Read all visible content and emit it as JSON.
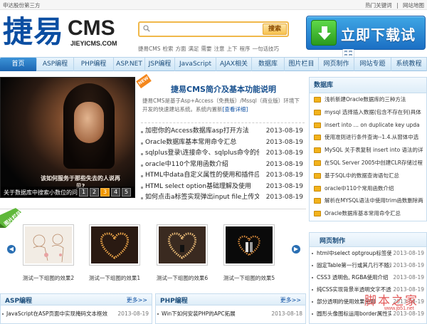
{
  "topbar": {
    "left_text": "申达股份第三方",
    "hot_link": "热门关键词",
    "sep": "|",
    "nav_link": "网站地图"
  },
  "logo": {
    "cn": "捷易",
    "en": "CMS",
    "url": "JIEYICMS.COM"
  },
  "search": {
    "placeholder": "",
    "button": "搜索"
  },
  "hotwords": [
    "捷易CMS",
    "检索",
    "方面",
    "满足",
    "需要",
    "注意",
    "上下",
    "程序",
    "一句话技巧"
  ],
  "download_button": "立即下载试用",
  "nav": [
    "首页",
    "ASP编程",
    "PHP编程",
    "ASP.NET",
    "JSP编程",
    "JavaScript",
    "AJAX相关",
    "数据库",
    "图片栏目",
    "网页制作",
    "网站专题",
    "系统教程"
  ],
  "slide": {
    "overlay_text": "该如何服务于那些失去的人说再见?",
    "caption": "关于数据库中搜索小数位的问题",
    "pages": [
      "1",
      "2",
      "3",
      "4",
      "5"
    ],
    "active_page": "3"
  },
  "intro": {
    "badge": "NEW",
    "title": "捷易CMS简介及基本功能说明",
    "desc": "捷易CMS是基于Asp+Access（免费版）/Mssql（商业版）环境下开发的快速建站系统。系统内置新",
    "more": "[查看详细]"
  },
  "articles": [
    {
      "title": "加密你的Access数据库asp打开方法",
      "date": "2013-08-19"
    },
    {
      "title": "Oracle数据库基本常用命令汇总",
      "date": "2013-08-19"
    },
    {
      "title": "sqlplus登录\\连接命令、sqlplus命令的使",
      "date": "2013-08-19"
    },
    {
      "title": "oracle中110个常用函数介绍",
      "date": "2013-08-19"
    },
    {
      "title": "HTML中data自定义属性的使用和插件应",
      "date": "2013-08-19"
    },
    {
      "title": "HTML select option基础理解及使用",
      "date": "2013-08-19"
    },
    {
      "title": "如何点击a标签实现弹出input file上传文",
      "date": "2013-08-19"
    }
  ],
  "db_panel": {
    "title": "数据库",
    "items": [
      "浅析新建Oracle数据库的三种方法",
      "mysql 选择插入数据(包含不存在列)具体",
      "insert into … on duplicate key upda",
      "使用准则进行条件查询--1.4.从窗体中选",
      "MySQL 关于表复制 insert into 语法的详",
      "在SQL Server 2005中创建CLR存储过程",
      "基于SQL中的数据查询语句汇总",
      "oracle中110个常用函数介绍",
      "解析在MYSQL语法中使用trim函数删除两",
      "Oracle数据库基本常用命令汇总"
    ]
  },
  "gallery": {
    "tag": "图片栏目",
    "items": [
      {
        "caption": "测试一下组图的效果2"
      },
      {
        "caption": "测试一下组图的效果1"
      },
      {
        "caption": "测试一下组图的效果6"
      },
      {
        "caption": "测试一下组图的效果5"
      }
    ]
  },
  "asp_panel": {
    "title": "ASP编程",
    "more": "更多>>",
    "items": [
      {
        "title": "JavaScript在ASP页面中实现掩码文本框效",
        "date": "2013-08-19"
      }
    ]
  },
  "php_panel": {
    "title": "PHP编程",
    "more": "更多>>",
    "items": [
      {
        "title": "Win下如何安装PHP的APC拓展",
        "date": "2013-08-18"
      }
    ]
  },
  "web_panel": {
    "title": "网页制作",
    "items": [
      {
        "title": "html中select optgroup标签使用介",
        "date": "2013-08-19"
      },
      {
        "title": "固定Table第一行或其几行不随滚",
        "date": "2013-08-19"
      },
      {
        "title": "CSS3 透明色, RGBA使用介绍",
        "date": "2013-08-19"
      },
      {
        "title": "纯CSS实现背景半透明文字不透明",
        "date": "2013-08-19"
      },
      {
        "title": "部分透明的使用效果使用",
        "date": "2013-08-19"
      },
      {
        "title": "圆形头像图标运用border属性实现",
        "date": "2013-08-19"
      }
    ]
  },
  "watermark": {
    "text": "脚本之家",
    "url": "www.jb51.net"
  },
  "colors": {
    "brand": "#0b4ea2",
    "accent": "#f39800",
    "nav_active": "#1b64b0"
  }
}
